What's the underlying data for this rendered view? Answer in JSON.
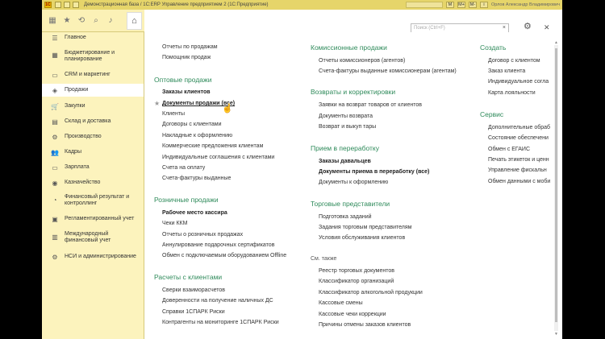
{
  "window": {
    "logo": "1С",
    "title": "Демонстрационная база / 1С:ERP Управление предприятием 2  (1С:Предприятие)",
    "user": "Орлов Александр Владимирович",
    "btn_m": "M",
    "btn_mplus": "M+",
    "btn_mminus": "M-",
    "btn_i": "i"
  },
  "search": {
    "placeholder": "Поиск (Ctrl+F)",
    "clear": "×"
  },
  "sidebar": {
    "items": [
      {
        "label": "Главное",
        "icon": "☰"
      },
      {
        "label": "Бюджетирование и планирование",
        "icon": "▦"
      },
      {
        "label": "CRM и маркетинг",
        "icon": "▭"
      },
      {
        "label": "Продажи",
        "icon": "◈"
      },
      {
        "label": "Закупки",
        "icon": "🛒"
      },
      {
        "label": "Склад и доставка",
        "icon": "▤"
      },
      {
        "label": "Производство",
        "icon": "⚙"
      },
      {
        "label": "Кадры",
        "icon": "👥"
      },
      {
        "label": "Зарплата",
        "icon": "▭"
      },
      {
        "label": "Казначейство",
        "icon": "◉"
      },
      {
        "label": "Финансовый результат и контроллинг",
        "icon": "◔"
      },
      {
        "label": "Регламентированный учет",
        "icon": "▣"
      },
      {
        "label": "Международный финансовый учет",
        "icon": "▥"
      },
      {
        "label": "НСИ и администрирование",
        "icon": "⚙"
      }
    ]
  },
  "col1": {
    "top_links": [
      "Отчеты по продажам",
      "Помощник продаж"
    ],
    "wholesale_h": "Оптовые продажи",
    "wholesale": [
      "Заказы клиентов",
      "Документы продажи (все)",
      "Клиенты",
      "Договоры с клиентами",
      "Накладные к оформлению",
      "Коммерческие предложения клиентам",
      "Индивидуальные соглашения с клиентами",
      "Счета на оплату",
      "Счета-фактуры выданные"
    ],
    "retail_h": "Розничные продажи",
    "retail": [
      "Рабочее место кассира",
      "Чеки ККМ",
      "Отчеты о розничных продажах",
      "Аннулирование подарочных сертификатов",
      "Обмен с подключаемым оборудованием Offline"
    ],
    "settle_h": "Расчеты с клиентами",
    "settle": [
      "Сверки взаиморасчетов",
      "Доверенности на получение наличных ДС",
      "Справки 1СПАРК Риски",
      "Контрагенты на мониторинге 1СПАРК Риски"
    ]
  },
  "col2": {
    "commission_h": "Комиссионные продажи",
    "commission": [
      "Отчеты комиссионеров (агентов)",
      "Счета-фактуры выданные комиссионерам (агентам)"
    ],
    "returns_h": "Возвраты и корректировки",
    "returns": [
      "Заявки на возврат товаров от клиентов",
      "Документы возврата",
      "Возврат и выкуп тары"
    ],
    "processing_h": "Прием в переработку",
    "processing": [
      "Заказы давальцев",
      "Документы приема в переработку (все)",
      "Документы к оформлению"
    ],
    "reps_h": "Торговые представители",
    "reps": [
      "Подготовка заданий",
      "Задания торговым представителям",
      "Условия обслуживания клиентов"
    ],
    "see_also_h": "См. также",
    "see_also": [
      "Реестр торговых документов",
      "Классификатор организаций",
      "Классификатор алкогольной продукции",
      "Кассовые смены",
      "Кассовые чеки коррекции",
      "Причины отмены заказов клиентов"
    ]
  },
  "col3": {
    "create_h": "Создать",
    "create": [
      "Договор с клиентом",
      "Заказ клиента",
      "Индивидуальное согла",
      "Карта лояльности"
    ],
    "service_h": "Сервис",
    "service": [
      "Дополнительные обраб",
      "Состояние обеспечени",
      "Обмен с ЕГАИС",
      "Печать этикеток и ценн",
      "Управление фискальн",
      "Обмен данными с моби"
    ]
  }
}
